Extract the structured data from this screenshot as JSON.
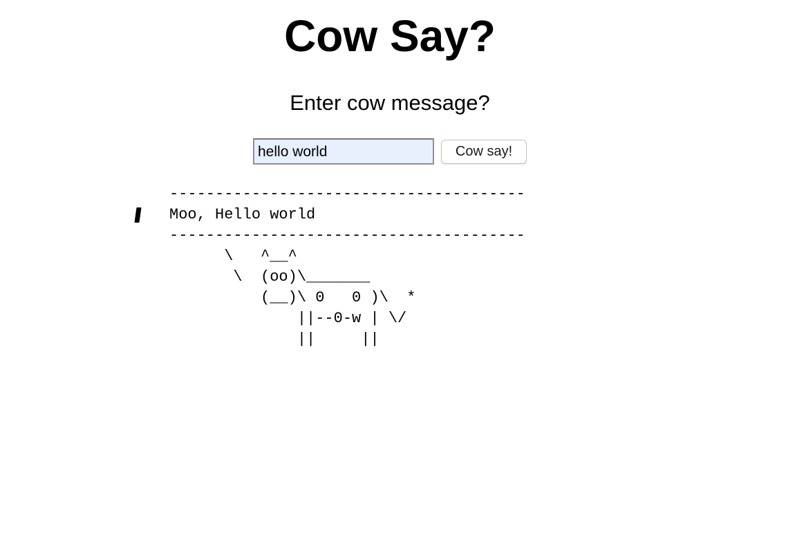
{
  "page": {
    "title": "Cow Say?",
    "prompt": "Enter cow message?"
  },
  "form": {
    "input_value": "hello world",
    "button_label": "Cow say!"
  },
  "output": {
    "cow_text": "---------------------------------------\nMoo, Hello world\n---------------------------------------\n      \\   ^__^\n       \\  (oo)\\_______\n          (__)\\ 0   0 )\\  *\n              ||--0-w | \\/\n              ||     ||"
  },
  "colors": {
    "input_background": "#e8f0fe",
    "text": "#000000",
    "page_background": "#ffffff"
  }
}
